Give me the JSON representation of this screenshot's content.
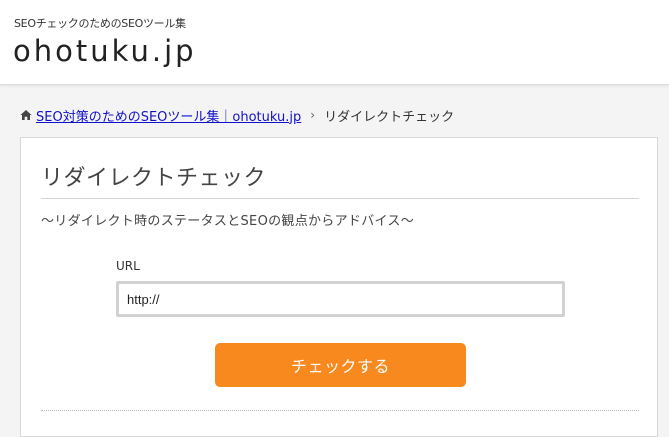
{
  "header": {
    "tagline": "SEOチェックのためのSEOツール集",
    "logo": "ohotuku.jp"
  },
  "breadcrumb": {
    "home_icon": "home-icon",
    "home_link": "SEO対策のためのSEOツール集｜ohotuku.jp",
    "separator": "›",
    "current": "リダイレクトチェック"
  },
  "main": {
    "title": "リダイレクトチェック",
    "subtitle": "～リダイレクト時のステータスとSEOの観点からアドバイス～",
    "form": {
      "url_label": "URL",
      "url_value": "http://",
      "submit_label": "チェックする"
    }
  },
  "colors": {
    "accent": "#f7891e",
    "link": "#1111cc"
  }
}
